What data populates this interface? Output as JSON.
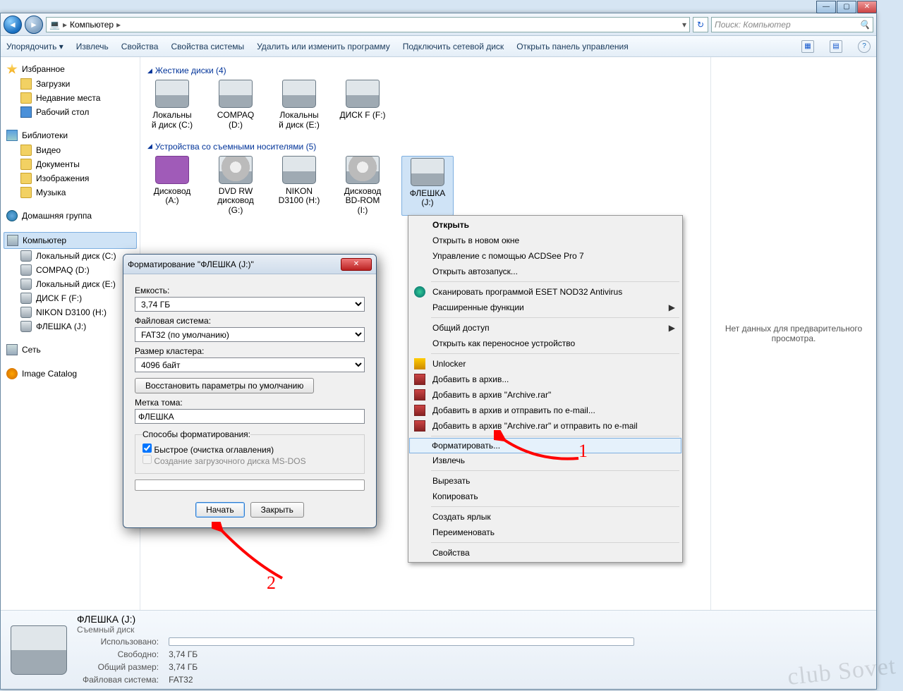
{
  "titlebar": {
    "min": "—",
    "max": "▢",
    "close": "✕"
  },
  "nav": {
    "back": "◄",
    "fwd": "►",
    "icon": "💻",
    "segments": [
      "Компьютер"
    ],
    "refresh": "↻",
    "search_placeholder": "Поиск: Компьютер",
    "search_icon": "🔍"
  },
  "toolbar": {
    "organize": "Упорядочить ▾",
    "eject": "Извлечь",
    "props": "Свойства",
    "sysprops": "Свойства системы",
    "programs": "Удалить или изменить программу",
    "mapdrive": "Подключить сетевой диск",
    "cp": "Открыть панель управления",
    "view": "▦",
    "pane": "▤",
    "help": "?"
  },
  "sidebar": {
    "fav": "Избранное",
    "fav_items": [
      "Загрузки",
      "Недавние места",
      "Рабочий стол"
    ],
    "lib": "Библиотеки",
    "lib_items": [
      "Видео",
      "Документы",
      "Изображения",
      "Музыка"
    ],
    "hg": "Домашняя группа",
    "comp": "Компьютер",
    "comp_items": [
      "Локальный диск (C:)",
      "COMPAQ (D:)",
      "Локальный диск (E:)",
      "ДИСК F (F:)",
      "NIKON D3100 (H:)",
      "ФЛЕШКА (J:)"
    ],
    "net": "Сеть",
    "cat": "Image Catalog"
  },
  "main": {
    "sec1": "Жесткие диски (4)",
    "hdd": [
      {
        "l1": "Локальны",
        "l2": "й диск (C:)"
      },
      {
        "l1": "COMPAQ",
        "l2": "(D:)"
      },
      {
        "l1": "Локальны",
        "l2": "й диск (E:)"
      },
      {
        "l1": "ДИСК F (F:)",
        "l2": ""
      }
    ],
    "sec2": "Устройства со съемными носителями (5)",
    "rem": [
      {
        "l1": "Дисковод",
        "l2": "(A:)",
        "t": "floppy"
      },
      {
        "l1": "DVD RW",
        "l2": "дисковод",
        "l3": "(G:)",
        "t": "dvd"
      },
      {
        "l1": "NIKON",
        "l2": "D3100 (H:)",
        "t": "hdd"
      },
      {
        "l1": "Дисковод",
        "l2": "BD-ROM",
        "l3": "(I:)",
        "t": "dvd"
      },
      {
        "l1": "ФЛЕШКА",
        "l2": "(J:)",
        "t": "hdd",
        "sel": true
      }
    ]
  },
  "preview": "Нет данных для предварительного просмотра.",
  "ctx": {
    "items": [
      {
        "t": "Открыть",
        "bold": true
      },
      {
        "t": "Открыть в новом окне"
      },
      {
        "t": "Управление с помощью ACDSee Pro 7"
      },
      {
        "t": "Открыть автозапуск..."
      },
      {
        "sep": true
      },
      {
        "t": "Сканировать программой ESET NOD32 Antivirus",
        "ic": "eset"
      },
      {
        "t": "Расширенные функции",
        "sub": "▶"
      },
      {
        "sep": true
      },
      {
        "t": "Общий доступ",
        "sub": "▶"
      },
      {
        "t": "Открыть как переносное устройство"
      },
      {
        "sep": true
      },
      {
        "t": "Unlocker",
        "ic": "unlk"
      },
      {
        "t": "Добавить в архив...",
        "ic": "rar"
      },
      {
        "t": "Добавить в архив \"Archive.rar\"",
        "ic": "rar"
      },
      {
        "t": "Добавить в архив и отправить по e-mail...",
        "ic": "rar"
      },
      {
        "t": "Добавить в архив \"Archive.rar\" и отправить по e-mail",
        "ic": "rar"
      },
      {
        "sep": true
      },
      {
        "t": "Форматировать...",
        "hl": true
      },
      {
        "t": "Извлечь"
      },
      {
        "sep": true
      },
      {
        "t": "Вырезать"
      },
      {
        "t": "Копировать"
      },
      {
        "sep": true
      },
      {
        "t": "Создать ярлык"
      },
      {
        "t": "Переименовать"
      },
      {
        "sep": true
      },
      {
        "t": "Свойства"
      }
    ]
  },
  "dlg": {
    "title": "Форматирование \"ФЛЕШКА (J:)\"",
    "cap_label": "Емкость:",
    "cap_val": "3,74 ГБ",
    "fs_label": "Файловая система:",
    "fs_val": "FAT32 (по умолчанию)",
    "au_label": "Размер кластера:",
    "au_val": "4096 байт",
    "restore": "Восстановить параметры по умолчанию",
    "vol_label": "Метка тома:",
    "vol_val": "ФЛЕШКА",
    "opts_legend": "Способы форматирования:",
    "quick": "Быстрое (очистка оглавления)",
    "msdos": "Создание загрузочного диска MS-DOS",
    "start": "Начать",
    "close": "Закрыть"
  },
  "details": {
    "name": "ФЛЕШКА (J:)",
    "type": "Съемный диск",
    "used_l": "Использовано:",
    "free_l": "Свободно:",
    "free_v": "3,74 ГБ",
    "total_l": "Общий размер:",
    "total_v": "3,74 ГБ",
    "fs_l": "Файловая система:",
    "fs_v": "FAT32"
  },
  "anno": {
    "n1": "1",
    "n2": "2"
  },
  "watermark": "club Sovet"
}
